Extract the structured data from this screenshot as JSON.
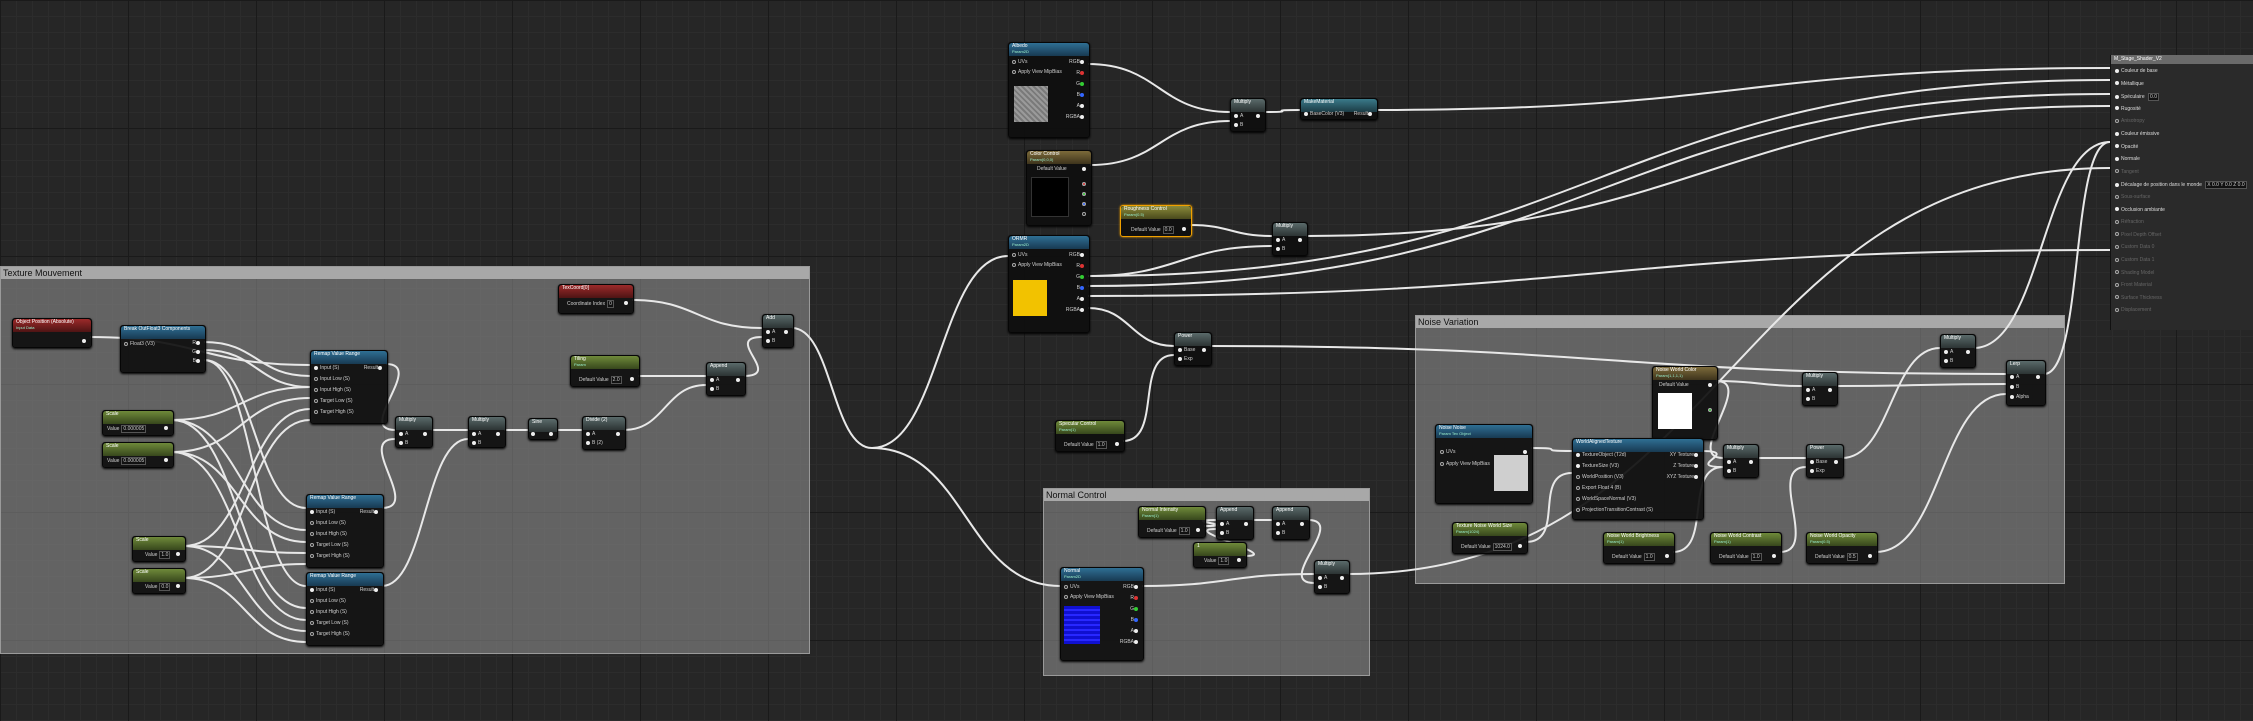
{
  "colors": {
    "wire": "#e8e8e8",
    "blue_preview": "#1010d0",
    "yellow_preview": "#f2c200",
    "background": "#262626"
  },
  "comments": {
    "texture_mouvement": "Texture Mouvement",
    "normal_control": "Normal Control",
    "noise_variation": "Noise Variation"
  },
  "nodes": {
    "object_position": {
      "title": "Object Position (Absolute)",
      "sub": "Input Data"
    },
    "break_float3": {
      "title": "Break OutFloat3 Components",
      "in": "Float3 (V3)",
      "outs": [
        "R",
        "G",
        "B"
      ]
    },
    "scalar_a": {
      "title": "Scale",
      "value_label": "Value",
      "value": "0.000005"
    },
    "scalar_b": {
      "title": "Scale",
      "value_label": "Value",
      "value": "0.000005"
    },
    "scalar_c": {
      "title": "Scale",
      "value_label": "Value",
      "value": "1.0"
    },
    "scalar_d": {
      "title": "Scale",
      "value_label": "Value",
      "value": "0.0"
    },
    "range1": {
      "title": "Remap Value Range",
      "pins": [
        "Input (S)",
        "Input Low (S)",
        "Input High (S)",
        "Target Low (S)",
        "Target High (S)"
      ],
      "out": "Result"
    },
    "range2": {
      "title": "Remap Value Range",
      "pins": [
        "Input (S)",
        "Input Low (S)",
        "Input High (S)",
        "Target Low (S)",
        "Target High (S)"
      ],
      "out": "Result"
    },
    "range3": {
      "title": "Remap Value Range",
      "pins": [
        "Input (S)",
        "Input Low (S)",
        "Input High (S)",
        "Target Low (S)",
        "Target High (S)"
      ],
      "out": "Result"
    },
    "texcoord": {
      "title": "TexCoord[0]",
      "pin": "Coordinate Index",
      "value": "0"
    },
    "tiling": {
      "title": "Tiling",
      "sub": "Param",
      "default_label": "Default Value",
      "value": "2.0"
    },
    "multiply1": {
      "title": "Multiply",
      "a": "A",
      "b": "B"
    },
    "multiply2": {
      "title": "Multiply",
      "a": "A",
      "b": "B"
    },
    "sine": {
      "title": "Sine"
    },
    "divide": {
      "title": "Divide (2)",
      "a": "A",
      "b": "B (2)"
    },
    "append1": {
      "title": "Append",
      "a": "A",
      "b": "B"
    },
    "add1": {
      "title": "Add",
      "a": "A",
      "b": "B"
    },
    "albedo": {
      "title": "Albedo",
      "sub": "Param2D",
      "pins": [
        "UVs",
        "Apply View MipBias"
      ],
      "outs": [
        "RGB",
        "R",
        "G",
        "B",
        "A",
        "RGBA"
      ]
    },
    "color_control": {
      "title": "Color Control",
      "sub": "Param(0,0,0)",
      "default_label": "Default Value",
      "outs": [
        "",
        "",
        "",
        "",
        ""
      ]
    },
    "multiply_top": {
      "title": "Multiply",
      "a": "A",
      "b": "B"
    },
    "make_material": {
      "title": "MakeMaterial",
      "pins": [
        "BaseColor (V3)",
        "Result"
      ]
    },
    "roughness_control": {
      "title": "Roughness Control",
      "sub": "Param(0.5)",
      "default_label": "Default Value",
      "value": "0.0"
    },
    "orm": {
      "title": "ORMR",
      "sub": "Param2D",
      "pins": [
        "UVs",
        "Apply View MipBias"
      ],
      "outs": [
        "RGB",
        "R",
        "G",
        "B",
        "A",
        "RGBA"
      ]
    },
    "multiply_orm": {
      "title": "Multiply",
      "a": "A",
      "b": "B"
    },
    "power": {
      "title": "Power",
      "a": "Base",
      "b": "Exp"
    },
    "specular_control": {
      "title": "Specular Control",
      "sub": "Param(1)",
      "default_label": "Default Value",
      "value": "1.0"
    },
    "normal_intensity": {
      "title": "Normal Intensity",
      "sub": "Param(1)",
      "default_label": "Default Value",
      "value": "1.0"
    },
    "append_n1": {
      "title": "Append",
      "a": "A",
      "b": "B"
    },
    "append_n2": {
      "title": "Append",
      "a": "A",
      "b": "B"
    },
    "scalar_n": {
      "title": "1",
      "value_label": "Value",
      "value": "1.0"
    },
    "normal": {
      "title": "Normal",
      "sub": "Param2D",
      "pins": [
        "UVs",
        "Apply View MipBias"
      ],
      "outs": [
        "RGB",
        "R",
        "G",
        "B",
        "A",
        "RGBA"
      ]
    },
    "multiply_n": {
      "title": "Multiply",
      "a": "A",
      "b": "B"
    },
    "noise_color": {
      "title": "Noise World Color",
      "sub": "Param(1,1,1,1)",
      "default_label": "Default Value"
    },
    "world_aligned": {
      "title": "WorldAlignedTexture",
      "pins": [
        "TextureObject (T2d)",
        "TextureSize (V3)",
        "WorldPosition (V3)",
        "Export Float 4 (B)",
        "WorldSpaceNormal (V3)",
        "ProjectionTransitionContrast (S)"
      ],
      "outs": [
        "XY Texture",
        "Z Texture",
        "XYZ Texture"
      ]
    },
    "noise_tex": {
      "title": "Noise Noise",
      "sub": "Param Tex Object",
      "pins": [
        "UVs",
        "Apply View MipBias"
      ]
    },
    "noise_world_size": {
      "title": "Texture Noise World Size",
      "sub": "Param(1024)",
      "default_label": "Default Value",
      "value": "1024.0"
    },
    "noise_brightness": {
      "title": "Noise World Brightness",
      "sub": "Param(1)",
      "default_label": "Default Value",
      "value": "1.0"
    },
    "noise_contrast": {
      "title": "Noise World Contrast",
      "sub": "Param(1)",
      "default_label": "Default Value",
      "value": "1.0"
    },
    "noise_opacity": {
      "title": "Noise World Opacity",
      "sub": "Param(0.5)",
      "default_label": "Default Value",
      "value": "0.5"
    },
    "multiply_nw1": {
      "title": "Multiply",
      "a": "A",
      "b": "B"
    },
    "multiply_nw2": {
      "title": "Multiply",
      "a": "A",
      "b": "B"
    },
    "multiply_nw3": {
      "title": "Multiply",
      "a": "A",
      "b": "B"
    },
    "power_nw": {
      "title": "Power",
      "a": "Base",
      "b": "Exp"
    },
    "lerp": {
      "title": "Lerp",
      "a": "A",
      "b": "B",
      "alpha": "Alpha"
    }
  },
  "result_panel": {
    "title": "M_Stage_Shader_V2",
    "rows": [
      {
        "label": "Couleur de base",
        "active": true
      },
      {
        "label": "Métallique",
        "active": true
      },
      {
        "label": "Spéculaire",
        "active": true,
        "value": "0.0"
      },
      {
        "label": "Rugosité",
        "active": true
      },
      {
        "label": "Anisotropy",
        "active": false
      },
      {
        "label": "Couleur émissive",
        "active": true
      },
      {
        "label": "Opacité",
        "active": true
      },
      {
        "label": "Normale",
        "active": true
      },
      {
        "label": "Tangent",
        "active": false
      },
      {
        "label": "Décalage de position dans le monde",
        "active": true,
        "value": "X 0.0 Y 0.0 Z 0.0"
      },
      {
        "label": "Sous-surface",
        "active": false
      },
      {
        "label": "Occlusion ambiante",
        "active": true
      },
      {
        "label": "Réfraction",
        "active": false
      },
      {
        "label": "Pixel Depth Offset",
        "active": false
      },
      {
        "label": "Custom Data 0",
        "active": false
      },
      {
        "label": "Custom Data 1",
        "active": false
      },
      {
        "label": "Shading Model",
        "active": false
      },
      {
        "label": "Front Material",
        "active": false
      },
      {
        "label": "Surface Thickness",
        "active": false
      },
      {
        "label": "Displacement",
        "active": false
      }
    ]
  }
}
